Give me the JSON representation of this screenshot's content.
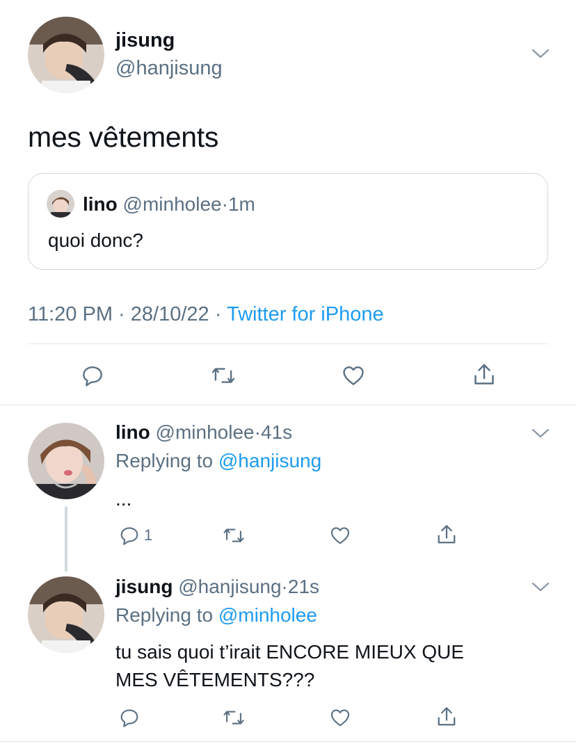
{
  "main_tweet": {
    "name": "jisung",
    "handle": "@hanjisung",
    "text": "mes vêtements",
    "quote": {
      "name": "lino",
      "handle": "@minholee",
      "sep": "·",
      "time": "1m",
      "text": "quoi donc?"
    },
    "meta": {
      "time": "11:20 PM",
      "sep1": "·",
      "date": "28/10/22",
      "sep2": "·",
      "source": "Twitter for iPhone"
    }
  },
  "replies": [
    {
      "name": "lino",
      "handle": "@minholee",
      "sep": "·",
      "time": "41s",
      "replying_prefix": "Replying to",
      "replying_to": "@hanjisung",
      "text": "...",
      "reply_count": "1"
    },
    {
      "name": "jisung",
      "handle": "@hanjisung",
      "sep": "·",
      "time": "21s",
      "replying_prefix": "Replying to",
      "replying_to": "@minholee",
      "text_line1": "tu sais quoi t’irait ENCORE MIEUX QUE",
      "text_line2": "MES VÊTEMENTS???"
    }
  ],
  "icons": [
    "reply-icon",
    "retweet-icon",
    "like-icon",
    "share-icon",
    "chevron-down-icon"
  ],
  "colors": {
    "link": "#1d9bf0",
    "secondary": "#5b7083",
    "text": "#0f1419",
    "border": "#cfd9de"
  }
}
